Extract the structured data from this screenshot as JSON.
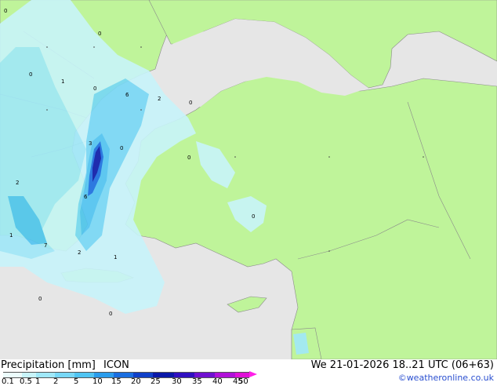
{
  "title": "Precipitation [mm]",
  "model": "ICON",
  "valid_time": "We 21-01-2026 18..21 UTC (06+63)",
  "credit": "©weatheronline.co.uk",
  "colors": {
    "land": "#bff49a",
    "sea": "#e6e6e6",
    "border": "#888888"
  },
  "legend": {
    "ticks": [
      "0.1",
      "0.5",
      "1",
      "2",
      "5",
      "10",
      "15",
      "20",
      "25",
      "30",
      "35",
      "40",
      "45",
      "50"
    ],
    "colors": [
      "#ecfcfc",
      "#c8f4fa",
      "#a0e8f8",
      "#78d8f6",
      "#50c4f2",
      "#2a9cec",
      "#1a6ee0",
      "#1040c8",
      "#0a18a8",
      "#3010c0",
      "#7010d0",
      "#b010d8",
      "#e010d8",
      "#ff20e8"
    ]
  },
  "map_labels": [
    "0",
    "0",
    "0",
    "1",
    "0",
    "6",
    "2",
    "0",
    "3",
    "0",
    "0",
    "2",
    "6",
    "1",
    "7",
    "2",
    "1",
    "0",
    "0",
    "0"
  ]
}
